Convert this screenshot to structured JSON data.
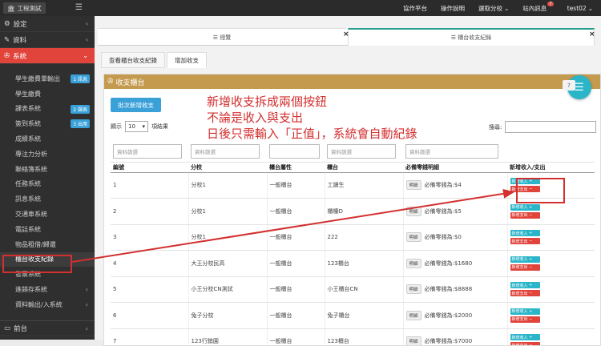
{
  "topbar": {
    "brand": "工程測試",
    "nav": [
      "協作平台",
      "操作說明",
      "選取分校",
      "站內訊息",
      "test02"
    ],
    "msg_count": "7"
  },
  "sidebar": {
    "sections": [
      {
        "label": "設定"
      },
      {
        "label": "資料"
      },
      {
        "label": "系統"
      }
    ],
    "items": [
      {
        "label": "學生繳費單輸出",
        "tag": "1 訊息"
      },
      {
        "label": "學生繳費"
      },
      {
        "label": "課表系統",
        "tag": "2 課表"
      },
      {
        "label": "簽到系統",
        "tag": "3 出席"
      },
      {
        "label": "成績系統"
      },
      {
        "label": "專注力分析"
      },
      {
        "label": "聯絡簿系統"
      },
      {
        "label": "任務系統"
      },
      {
        "label": "訊息系統"
      },
      {
        "label": "交通車系統"
      },
      {
        "label": "電話系統"
      },
      {
        "label": "物品租借/歸還"
      },
      {
        "label": "櫃台收支紀錄"
      },
      {
        "label": "發票系統"
      },
      {
        "label": "進銷存系統"
      },
      {
        "label": "資料輸出/入系統"
      }
    ],
    "bottom": "前台"
  },
  "panel_tabs": [
    {
      "label": "總覽"
    },
    {
      "label": "櫃台收支紀錄"
    }
  ],
  "subtabs": [
    "查看櫃台收支紀錄",
    "增加收支"
  ],
  "panel_title": "收支櫃台",
  "batch_button": "批次新增收支",
  "length": {
    "show": "顯示",
    "value": "10",
    "suffix": "項結果"
  },
  "search_label": "搜尋:",
  "filter_placeholder": "資料篩選",
  "annotation": [
    "新增收支拆成兩個按鈕",
    "不論是收入與支出",
    "日後只需輸入「正值」，系統會自動紀錄"
  ],
  "columns": [
    "編號",
    "分校",
    "櫃台屬性",
    "櫃台",
    "必備零錢明細",
    "新增收入/支出"
  ],
  "detail_label": "明細",
  "income_label": "新增收入",
  "expense_label": "新增支出",
  "rows": [
    {
      "id": "1",
      "school": "分校1",
      "attr": "一般櫃台",
      "counter": "工讀生",
      "change": "必備零錢為:$4"
    },
    {
      "id": "2",
      "school": "分校1",
      "attr": "一般櫃台",
      "counter": "櫃檯D",
      "change": "必備零錢為:$5"
    },
    {
      "id": "3",
      "school": "分校1",
      "attr": "一般櫃台",
      "counter": "222",
      "change": "必備零錢為:$0"
    },
    {
      "id": "4",
      "school": "大王分校民高",
      "attr": "一般櫃台",
      "counter": "123櫃台",
      "change": "必備零錢為:$1680"
    },
    {
      "id": "5",
      "school": "小王分校CN測試",
      "attr": "一般櫃台",
      "counter": "小王櫃台CN",
      "change": "必備零錢為:$8888"
    },
    {
      "id": "6",
      "school": "兔子分校",
      "attr": "一般櫃台",
      "counter": "兔子櫃台",
      "change": "必備零錢為:$2000"
    },
    {
      "id": "7",
      "school": "123行銷園",
      "attr": "一般櫃台",
      "counter": "123櫃台",
      "change": "必備零錢為:$7000"
    }
  ],
  "colors": {
    "accent": "#e0443a",
    "panel_header": "#c49a4e",
    "info": "#2bb5c9",
    "annotation": "#d32f2f"
  }
}
